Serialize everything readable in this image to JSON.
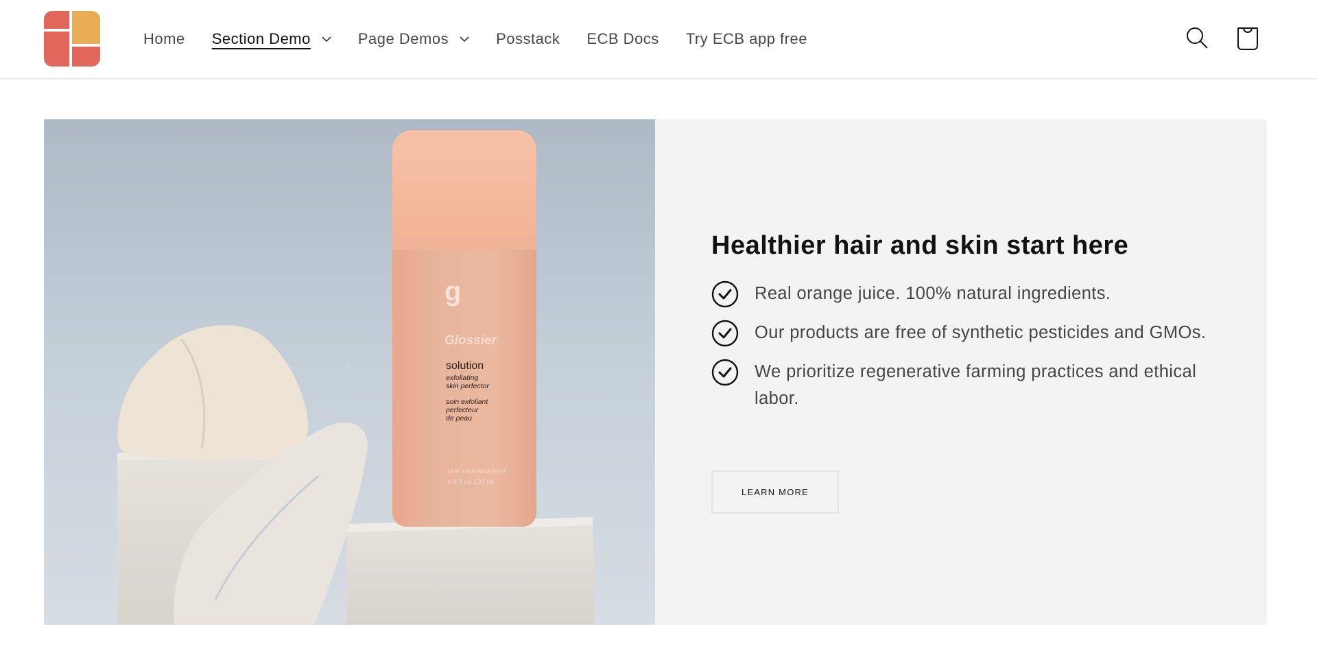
{
  "header": {
    "logo_alt": "Logo",
    "logo_colors": {
      "primary": "#e1675a",
      "accent": "#e9ad55"
    },
    "nav": [
      {
        "label": "Home",
        "has_dropdown": false,
        "active": false
      },
      {
        "label": "Section Demo",
        "has_dropdown": true,
        "active": true
      },
      {
        "label": "Page Demos",
        "has_dropdown": true,
        "active": false
      },
      {
        "label": "Posstack",
        "has_dropdown": false,
        "active": false
      },
      {
        "label": "ECB Docs",
        "has_dropdown": false,
        "active": false
      },
      {
        "label": "Try ECB app free",
        "has_dropdown": false,
        "active": false
      }
    ],
    "icons": {
      "search": "search-icon",
      "cart": "cart-icon"
    }
  },
  "feature": {
    "image": {
      "description": "Glossier Solution bottle on white blocks with chalk rocks",
      "bottle_text": {
        "brand": "Glossier",
        "product": "solution",
        "subtitle_en_1": "exfoliating",
        "subtitle_en_2": "skin perfector",
        "subtitle_fr_1": "soin exfoliant",
        "subtitle_fr_2": "perfecteur",
        "subtitle_fr_3": "de peau",
        "spec_1": "10% AHA/BHA/PHA",
        "spec_2": "4.4 fl oz 130 ml"
      }
    },
    "heading": "Healthier hair and skin start here",
    "list": [
      {
        "icon": "check-circle-icon",
        "text": "Real orange juice. 100% natural ingredients."
      },
      {
        "icon": "check-circle-icon",
        "text": "Our products are free of synthetic pesticides and GMOs."
      },
      {
        "icon": "check-circle-icon",
        "text": "We prioritize regenerative farming practices and ethical labor."
      }
    ],
    "button_label": "LEARN MORE",
    "panel_color": "#f3f3f3"
  }
}
